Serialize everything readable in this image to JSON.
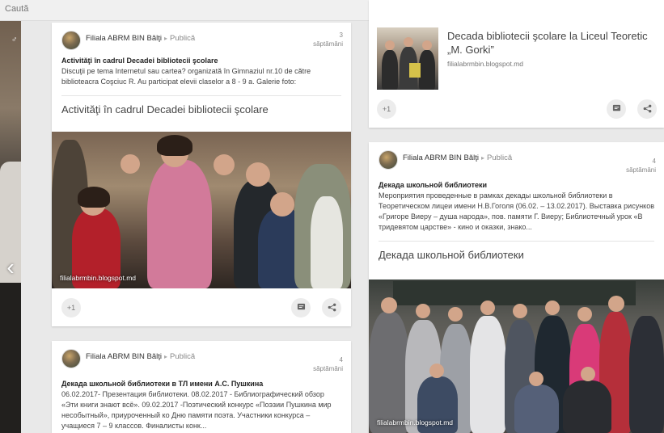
{
  "search": {
    "placeholder": "Caută"
  },
  "colors": {
    "page_bg": "#e9e9e9",
    "card_bg": "#ffffff",
    "link_text": "#404040"
  },
  "card1": {
    "author": "Filiala ABRM BIN Bălţi",
    "audience": "Publică",
    "time_num": "3",
    "time_unit": "săptămâni",
    "title": "Activităţi în cadrul Decadei bibliotecii şcolare",
    "body": "Discuţii pe tema Internetul sau cartea? organizată în Gimnaziul nr.10 de către biblioteacra Coşciuc R. Au participat elevii claselor a 8 - 9 a. Galerie foto:",
    "link_title": "Activităţi în cadrul Decadei bibliotecii şcolare",
    "photo_caption": "filialabrmbin.blogspot.md",
    "plus_one": "+1"
  },
  "card2": {
    "link_title": "Decada bibliotecii şcolare la Liceul Teoretic „M. Gorki”",
    "link_domain": "filialabrmbin.blogspot.md",
    "plus_one": "+1"
  },
  "card3": {
    "author": "Filiala ABRM BIN Bălţi",
    "audience": "Publică",
    "time_num": "4",
    "time_unit": "săptămâni",
    "title": "Декада школьной библиотеки",
    "body": "Мероприятия проведенные в рамках декады школьной библиотеки в Теоретическом лицеи имени Н.В.Гоголя (06.02. – 13.02.2017). Выставка рисунков «Григоре Виеру – душа народа», пов. памяти Г. Виеру; Библиотечный урок «В тридевятом царстве» - кино и оказки, знако...",
    "link_title": "Декада школьной библиотеки",
    "photo_caption": "filialabrmbin.blogspot.md"
  },
  "card4": {
    "author": "Filiala ABRM BIN Bălţi",
    "audience": "Publică",
    "time_num": "4",
    "time_unit": "săptămâni",
    "title": "Декада школьной библиотеки в ТЛ имени А.С. Пушкина",
    "body": "06.02.2017- Презентация библиотеки.  08.02.2017 - Библиографический обзор «Эти книги знают всё».  09.02.2017 -Поэтический конкурс «Поэзии Пушкина мир несобытный», приуроченный ко Дню памяти поэта.  Участники конкурса – учащиеся 7 – 9 классов. Финалисты конк..."
  },
  "icons": {
    "comment": "comment-icon",
    "share": "share-icon",
    "nav_left": "chevron-left-icon"
  }
}
